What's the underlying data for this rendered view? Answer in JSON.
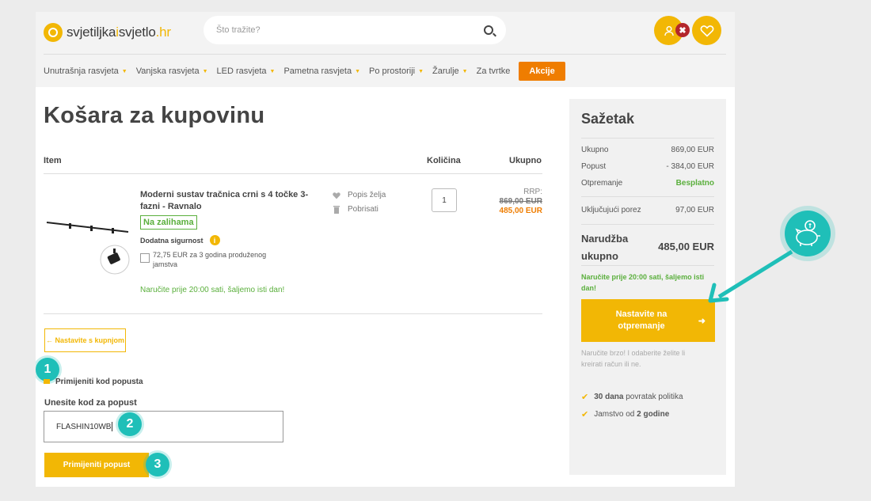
{
  "header": {
    "logo": {
      "part1": "svjetiljka",
      "part2": "i",
      "part3": "svjetlo",
      "tld": ".hr"
    },
    "search_placeholder": "Što tražite?",
    "badge": "✖"
  },
  "nav": {
    "items": [
      "Unutrašnja rasvjeta",
      "Vanjska rasvjeta",
      "LED rasvjeta",
      "Pametna rasvjeta",
      "Po prostoriji",
      "Žarulje"
    ],
    "plain": "Za tvrtke",
    "promo": "Akcije"
  },
  "page_title": "Košara za kupovinu",
  "table": {
    "headers": {
      "item": "Item",
      "qty": "Količina",
      "total": "Ukupno"
    },
    "product": {
      "name": "Moderni sustav tračnica crni s 4 točke 3-fazni - Ravnalo",
      "stock": "Na zalihama",
      "extra_security": "Dodatna sigurnost",
      "info": "i",
      "warranty": "72,75 EUR za 3 godina produženog jamstva",
      "order_note": "Naručite prije 20:00 sati, šaljemo isti dan!",
      "wishlist": "Popis želja",
      "remove": "Pobrisati",
      "quantity": "1",
      "rrp_label": "RRP:",
      "old_price": "869,00 EUR",
      "price": "485,00 EUR"
    }
  },
  "continue_shopping": "← Nastavite s kupnjom",
  "discount": {
    "toggle_label": "Primijeniti kod popusta",
    "input_label": "Unesite kod za popust",
    "code_value": "FLASHIN10WB",
    "apply_label": "Primijeniti popust"
  },
  "steps": [
    "1",
    "2",
    "3"
  ],
  "summary": {
    "title": "Sažetak",
    "rows": [
      {
        "label": "Ukupno",
        "value": "869,00 EUR"
      },
      {
        "label": "Popust",
        "value": "- 384,00 EUR"
      },
      {
        "label": "Otpremanje",
        "value": "Besplatno"
      },
      {
        "label": "Uključujući porez",
        "value": "97,00 EUR"
      }
    ],
    "total_label_1": "Narudžba",
    "total_label_2": "ukupno",
    "total_value": "485,00 EUR",
    "order_note": "Naručite prije 20:00 sati, šaljemo isti dan!",
    "checkout_label": "Nastavite na otpremanje",
    "checkout_arrow": "➜",
    "hint": "Naručite brzo! I odaberite želite li kreirati račun ili ne.",
    "perks": [
      {
        "bold": "30 dana",
        "text": " povratak politika"
      },
      {
        "text": "Jamstvo od ",
        "bold": "2 godine"
      }
    ]
  },
  "colors": {
    "accent": "#f2b705",
    "promo": "#ef7d00",
    "teal": "#1fbfb8",
    "green": "#5aaf3c"
  }
}
